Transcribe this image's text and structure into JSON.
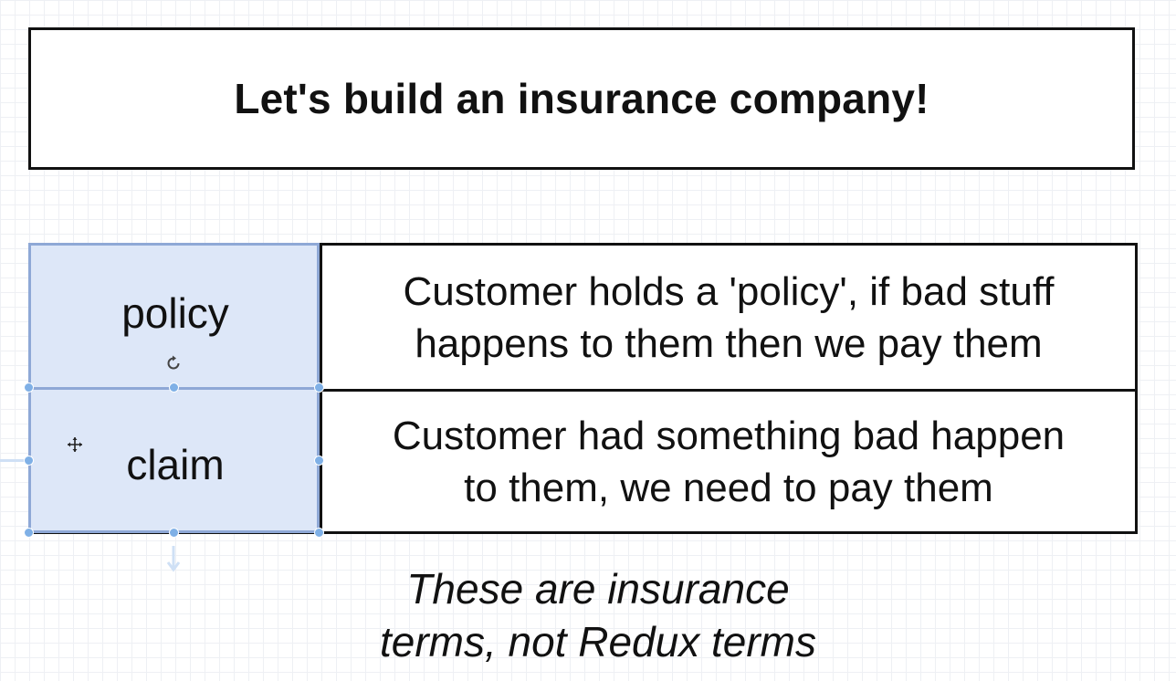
{
  "title": "Let's build an insurance company!",
  "rows": [
    {
      "term": "policy",
      "description_line1": "Customer holds a 'policy', if bad stuff",
      "description_line2": "happens to them then we pay them"
    },
    {
      "term": "claim",
      "description_line1": "Customer had something bad happen",
      "description_line2": "to them, we need to pay them"
    }
  ],
  "note": {
    "line1": "These are insurance",
    "line2": "terms, not Redux terms"
  },
  "colors": {
    "selection_fill": "#dde7f8",
    "selection_border": "#8ea8d6",
    "handle": "#7fb0e6",
    "border": "#111111"
  },
  "icons": [
    "rotate-icon",
    "move-icon",
    "down-arrow-icon"
  ]
}
